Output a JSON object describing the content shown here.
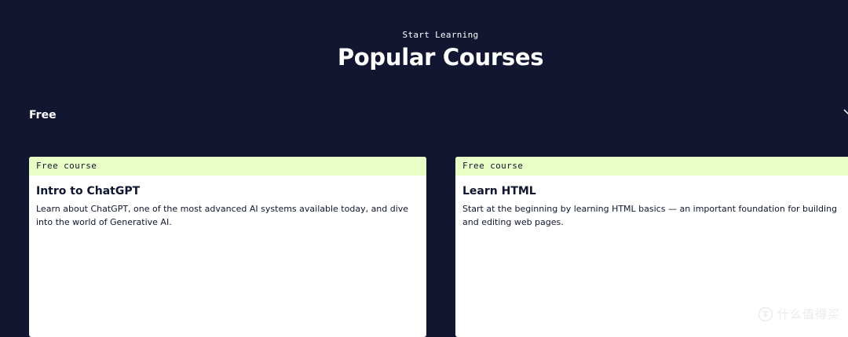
{
  "header": {
    "eyebrow": "Start Learning",
    "title": "Popular Courses"
  },
  "filter": {
    "selected": "Free",
    "icon": "chevron-down-icon"
  },
  "courses": [
    {
      "tag": "Free course",
      "title": "Intro to ChatGPT",
      "description": "Learn about ChatGPT, one of the most advanced AI systems available today, and dive into the world of Generative AI."
    },
    {
      "tag": "Free course",
      "title": "Learn HTML",
      "description": "Start at the beginning by learning HTML basics — an important foundation for building and editing web pages."
    }
  ],
  "watermark": {
    "text": "什么值得买"
  },
  "colors": {
    "background": "#121631",
    "tag_background": "#eafdc6",
    "text_dark": "#10162f",
    "text_light": "#ffffff"
  }
}
